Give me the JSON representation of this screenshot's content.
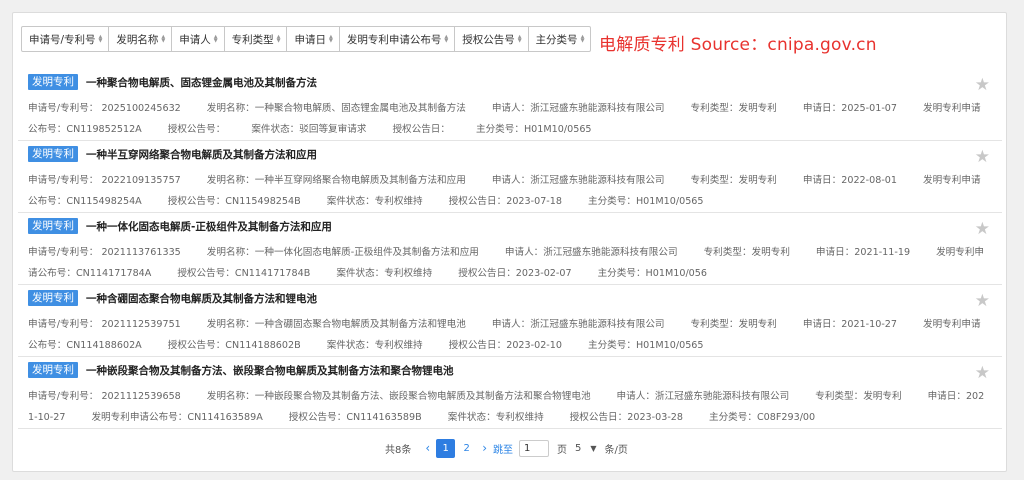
{
  "sort_headers": [
    {
      "label": "申请号/专利号"
    },
    {
      "label": "发明名称"
    },
    {
      "label": "申请人"
    },
    {
      "label": "专利类型"
    },
    {
      "label": "申请日"
    },
    {
      "label": "发明专利申请公布号"
    },
    {
      "label": "授权公告号"
    },
    {
      "label": "主分类号"
    }
  ],
  "watermark": "电解质专利   Source：cnipa.gov.cn",
  "records": [
    {
      "tag": "发明专利",
      "title": "一种聚合物电解质、固态锂金属电池及其制备方法",
      "fields": [
        "申请号/专利号： 2025100245632",
        "发明名称：一种聚合物电解质、固态锂金属电池及其制备方法",
        "申请人：浙江冠盛东驰能源科技有限公司",
        "专利类型：发明专利",
        "申请日：2025-01-07",
        "发明专利申请公布号：CN119852512A",
        "授权公告号：",
        "案件状态：驳回等复审请求",
        "授权公告日：",
        "主分类号：H01M10/0565"
      ]
    },
    {
      "tag": "发明专利",
      "title": "一种半互穿网络聚合物电解质及其制备方法和应用",
      "fields": [
        "申请号/专利号： 2022109135757",
        "发明名称：一种半互穿网络聚合物电解质及其制备方法和应用",
        "申请人：浙江冠盛东驰能源科技有限公司",
        "专利类型：发明专利",
        "申请日：2022-08-01",
        "发明专利申请公布号：CN115498254A",
        "授权公告号：CN115498254B",
        "案件状态：专利权维持",
        "授权公告日：2023-07-18",
        "主分类号：H01M10/0565"
      ]
    },
    {
      "tag": "发明专利",
      "title": "一种一体化固态电解质-正极组件及其制备方法和应用",
      "fields": [
        "申请号/专利号： 2021113761335",
        "发明名称：一种一体化固态电解质-正极组件及其制备方法和应用",
        "申请人：浙江冠盛东驰能源科技有限公司",
        "专利类型：发明专利",
        "申请日：2021-11-19",
        "发明专利申请公布号：CN114171784A",
        "授权公告号：CN114171784B",
        "案件状态：专利权维持",
        "授权公告日：2023-02-07",
        "主分类号：H01M10/056"
      ]
    },
    {
      "tag": "发明专利",
      "title": "一种含硼固态聚合物电解质及其制备方法和锂电池",
      "fields": [
        "申请号/专利号： 2021112539751",
        "发明名称：一种含硼固态聚合物电解质及其制备方法和锂电池",
        "申请人：浙江冠盛东驰能源科技有限公司",
        "专利类型：发明专利",
        "申请日：2021-10-27",
        "发明专利申请公布号：CN114188602A",
        "授权公告号：CN114188602B",
        "案件状态：专利权维持",
        "授权公告日：2023-02-10",
        "主分类号：H01M10/0565"
      ]
    },
    {
      "tag": "发明专利",
      "title": "一种嵌段聚合物及其制备方法、嵌段聚合物电解质及其制备方法和聚合物锂电池",
      "fields": [
        "申请号/专利号： 2021112539658",
        "发明名称：一种嵌段聚合物及其制备方法、嵌段聚合物电解质及其制备方法和聚合物锂电池",
        "申请人：浙江冠盛东驰能源科技有限公司",
        "专利类型：发明专利",
        "申请日：2021-10-27",
        "发明专利申请公布号：CN114163589A",
        "授权公告号：CN114163589B",
        "案件状态：专利权维持",
        "授权公告日：2023-03-28",
        "主分类号：C08F293/00"
      ]
    }
  ],
  "pagination": {
    "total": "共8条",
    "prev_icon": "chevron-left-icon",
    "next_icon": "chevron-right-icon",
    "pages": [
      "1",
      "2"
    ],
    "current": "1",
    "jump_label": "跳至",
    "jump_value": "1",
    "page_unit": "页",
    "page_size": "5",
    "page_size_unit": "条/页"
  },
  "colors": {
    "accent": "#2e7de1",
    "tag": "#3f8fe3",
    "watermark": "#e8322e"
  }
}
